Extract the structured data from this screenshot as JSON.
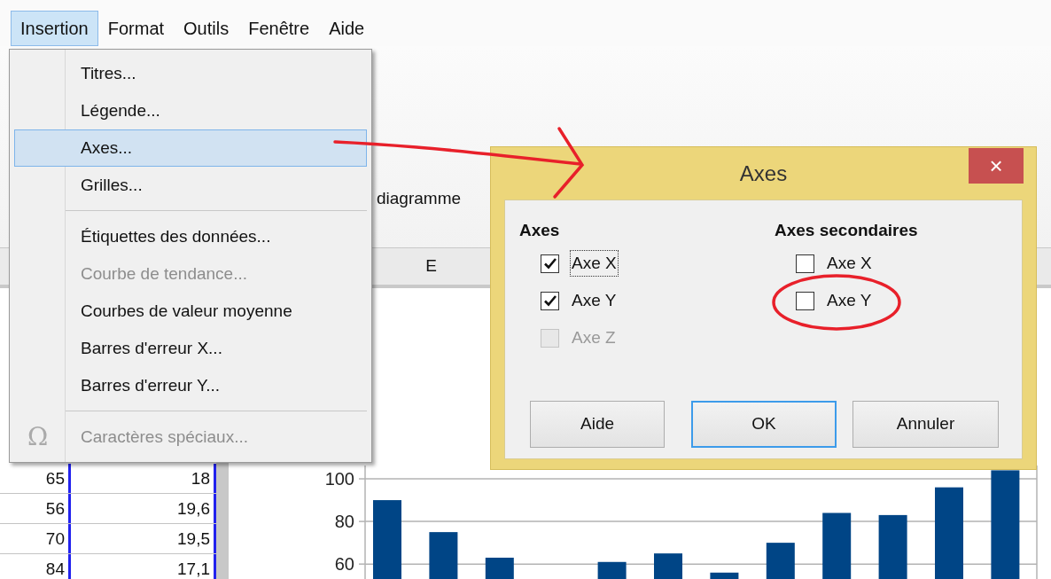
{
  "menubar": [
    {
      "label": "Insertion",
      "selected": true
    },
    {
      "label": "Format",
      "selected": false
    },
    {
      "label": "Outils",
      "selected": false
    },
    {
      "label": "Fenêtre",
      "selected": false
    },
    {
      "label": "Aide",
      "selected": false
    }
  ],
  "toolbar": {
    "text": "diagramme"
  },
  "column_header": "E",
  "menu": {
    "items": [
      {
        "kind": "item",
        "label": "Titres...",
        "selected": false,
        "disabled": false
      },
      {
        "kind": "item",
        "label": "Légende...",
        "selected": false,
        "disabled": false
      },
      {
        "kind": "item",
        "label": "Axes...",
        "selected": true,
        "disabled": false
      },
      {
        "kind": "item",
        "label": "Grilles...",
        "selected": false,
        "disabled": false
      },
      {
        "kind": "separator"
      },
      {
        "kind": "item",
        "label": "Étiquettes des données...",
        "selected": false,
        "disabled": false
      },
      {
        "kind": "item",
        "label": "Courbe de tendance...",
        "selected": false,
        "disabled": true
      },
      {
        "kind": "item",
        "label": "Courbes de valeur moyenne",
        "selected": false,
        "disabled": false
      },
      {
        "kind": "item",
        "label": "Barres d'erreur X...",
        "selected": false,
        "disabled": false
      },
      {
        "kind": "item",
        "label": "Barres d'erreur Y...",
        "selected": false,
        "disabled": false
      },
      {
        "kind": "separator"
      },
      {
        "kind": "item",
        "label": "Caractères spéciaux...",
        "selected": false,
        "disabled": true,
        "icon_glyph": "Ω"
      }
    ]
  },
  "sheet": {
    "rows": [
      [
        "65",
        "18"
      ],
      [
        "56",
        "19,6"
      ],
      [
        "70",
        "19,5"
      ],
      [
        "84",
        "17,1"
      ]
    ]
  },
  "chart": {
    "chart_data": {
      "type": "bar",
      "grid": true,
      "ylim": [
        53,
        106
      ],
      "yticks": [
        60,
        80,
        100
      ],
      "series": [
        {
          "color": "#004586",
          "values": [
            90,
            75,
            63,
            null,
            61,
            65,
            56,
            70,
            84,
            83,
            96,
            104
          ]
        }
      ]
    }
  },
  "dialog": {
    "title": "Axes",
    "close_label": "×",
    "groups": [
      {
        "heading": "Axes",
        "checkboxes": [
          {
            "label": "Axe X",
            "checked": true,
            "disabled": false,
            "focused": true
          },
          {
            "label": "Axe Y",
            "checked": true,
            "disabled": false,
            "focused": false
          },
          {
            "label": "Axe Z",
            "checked": false,
            "disabled": true,
            "focused": false
          }
        ]
      },
      {
        "heading": "Axes secondaires",
        "checkboxes": [
          {
            "label": "Axe X",
            "checked": false,
            "disabled": false,
            "focused": false
          },
          {
            "label": "Axe Y",
            "checked": false,
            "disabled": false,
            "focused": false
          }
        ]
      }
    ],
    "buttons": [
      {
        "label": "Aide",
        "default": false
      },
      {
        "label": "OK",
        "default": true
      },
      {
        "label": "Annuler",
        "default": false
      }
    ]
  }
}
